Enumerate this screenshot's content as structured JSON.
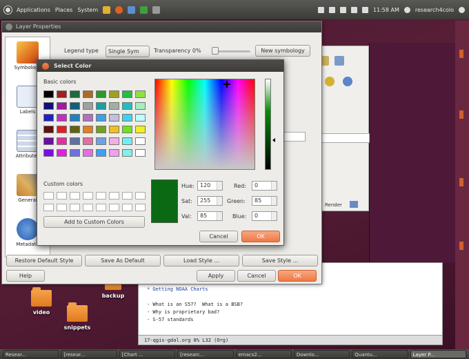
{
  "top_panel": {
    "menus": [
      "Applications",
      "Places",
      "System"
    ],
    "clock": "11:58 AM",
    "user": "research4colo"
  },
  "layer_properties": {
    "title": "Layer Properties",
    "legend_type_label": "Legend type",
    "legend_type_value": "Single Sym",
    "transparency_label": "Transparency 0%",
    "new_symbology_label": "New symbology",
    "sidebar": [
      {
        "label": "Symbology",
        "icon": "symbology-icon"
      },
      {
        "label": "Labels",
        "icon": "labels-icon"
      },
      {
        "label": "Attributes",
        "icon": "attributes-icon"
      },
      {
        "label": "General",
        "icon": "general-icon"
      },
      {
        "label": "Metadata",
        "icon": "metadata-icon"
      }
    ],
    "buttons": {
      "restore": "Restore Default Style",
      "save_default": "Save As Default",
      "load": "Load Style ...",
      "save": "Save Style ...",
      "help": "Help",
      "apply": "Apply",
      "cancel": "Cancel",
      "ok": "OK"
    }
  },
  "select_color": {
    "title": "Select Color",
    "basic_colors_label": "Basic colors",
    "custom_colors_label": "Custom colors",
    "add_custom_label": "Add to Custom Colors",
    "basic_colors": [
      "#000000",
      "#a02020",
      "#1e6a3a",
      "#b06a20",
      "#2a9a2a",
      "#a0a020",
      "#20c040",
      "#90e040",
      "#10107a",
      "#a01aa0",
      "#10607a",
      "#a0a0a0",
      "#1aa0a0",
      "#a0b0a0",
      "#20c0c0",
      "#a0f0c0",
      "#2020c0",
      "#c030c0",
      "#2080c0",
      "#b070c0",
      "#40a0e0",
      "#c0c0e0",
      "#40d0f0",
      "#c0ffff",
      "#601010",
      "#e02020",
      "#606010",
      "#e08020",
      "#70a020",
      "#f0c020",
      "#70e020",
      "#f0f020",
      "#6a10a0",
      "#e030a0",
      "#6070a0",
      "#e070a0",
      "#70a0e0",
      "#f0b0e0",
      "#70f0f0",
      "#ffffff",
      "#7a10e0",
      "#e020e0",
      "#7070e0",
      "#e070e0",
      "#40a0f0",
      "#f0a0f0",
      "#80f0f0",
      "#ffffff"
    ],
    "selected_color": "#0a6a14",
    "fields": {
      "hue": {
        "label": "Hue:",
        "value": "120"
      },
      "sat": {
        "label": "Sat:",
        "value": "255"
      },
      "val": {
        "label": "Val:",
        "value": "85"
      },
      "red": {
        "label": "Red:",
        "value": "0"
      },
      "green": {
        "label": "Green:",
        "value": "85"
      },
      "blue": {
        "label": "Blue:",
        "value": "0"
      }
    },
    "cancel_label": "Cancel",
    "ok_label": "OK"
  },
  "desktop_icons": [
    {
      "label": "video"
    },
    {
      "label": "snippets"
    },
    {
      "label": "backup"
    }
  ],
  "editor": {
    "lines": [
      "* Getting NOAA Charts",
      "- What is an S57?  What is a BSB?",
      "- Why is proprietary bad?",
      "- S-57 standards"
    ],
    "status": "17-qgis-gdal.org     8% L32     (Org)"
  },
  "qgis_window": {
    "renderer_label": "Render"
  },
  "taskbar": {
    "items": [
      "Resear...",
      "[resear...",
      "[Chart ...",
      "[researc...",
      "emacs2...",
      "Downlo...",
      "Quantu...",
      "Layer P..."
    ]
  }
}
